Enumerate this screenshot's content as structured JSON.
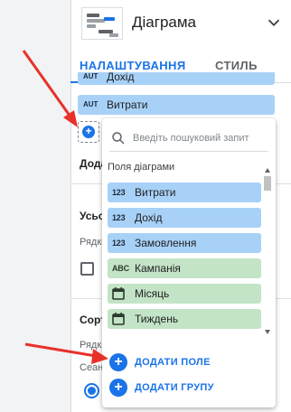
{
  "header": {
    "title": "Діаграма",
    "icon": "chart-thumbnail-icon",
    "collapse_icon": "chevron-down-icon"
  },
  "tabs": [
    {
      "label": "НАЛАШТУВАННЯ",
      "active": true
    },
    {
      "label": "СТИЛЬ",
      "active": false
    }
  ],
  "metrics": {
    "cut_type": "AUT",
    "cut_label": "Дохід",
    "row_type": "AUT",
    "row_label": "Витрати"
  },
  "side": {
    "add_label_partial": "Дода",
    "sort_head_partial": "Усьо",
    "rows_partial": "Рядки",
    "sort2_head_partial": "Сорту",
    "rows2_partial": "Рядк",
    "seance_partial": "Сеанс"
  },
  "dropdown": {
    "search_placeholder": "Введіть пошуковий запит",
    "list_header": "Поля діаграми",
    "fields": [
      {
        "type": "123",
        "label": "Витрати",
        "kind": "metric"
      },
      {
        "type": "123",
        "label": "Дохід",
        "kind": "metric"
      },
      {
        "type": "123",
        "label": "Замовлення",
        "kind": "metric"
      },
      {
        "type": "ABC",
        "label": "Кампанія",
        "kind": "dimension"
      },
      {
        "type": "calendar-icon",
        "label": "Місяць",
        "kind": "dimension"
      },
      {
        "type": "calendar-icon",
        "label": "Тиждень",
        "kind": "dimension"
      }
    ],
    "add_field": "ДОДАТИ ПОЛЕ",
    "add_group": "ДОДАТИ ГРУПУ"
  },
  "colors": {
    "accent": "#1a73e8",
    "metric": "#a8d1f7",
    "dimension": "#c3e4c6",
    "arrow": "#e8312a"
  }
}
